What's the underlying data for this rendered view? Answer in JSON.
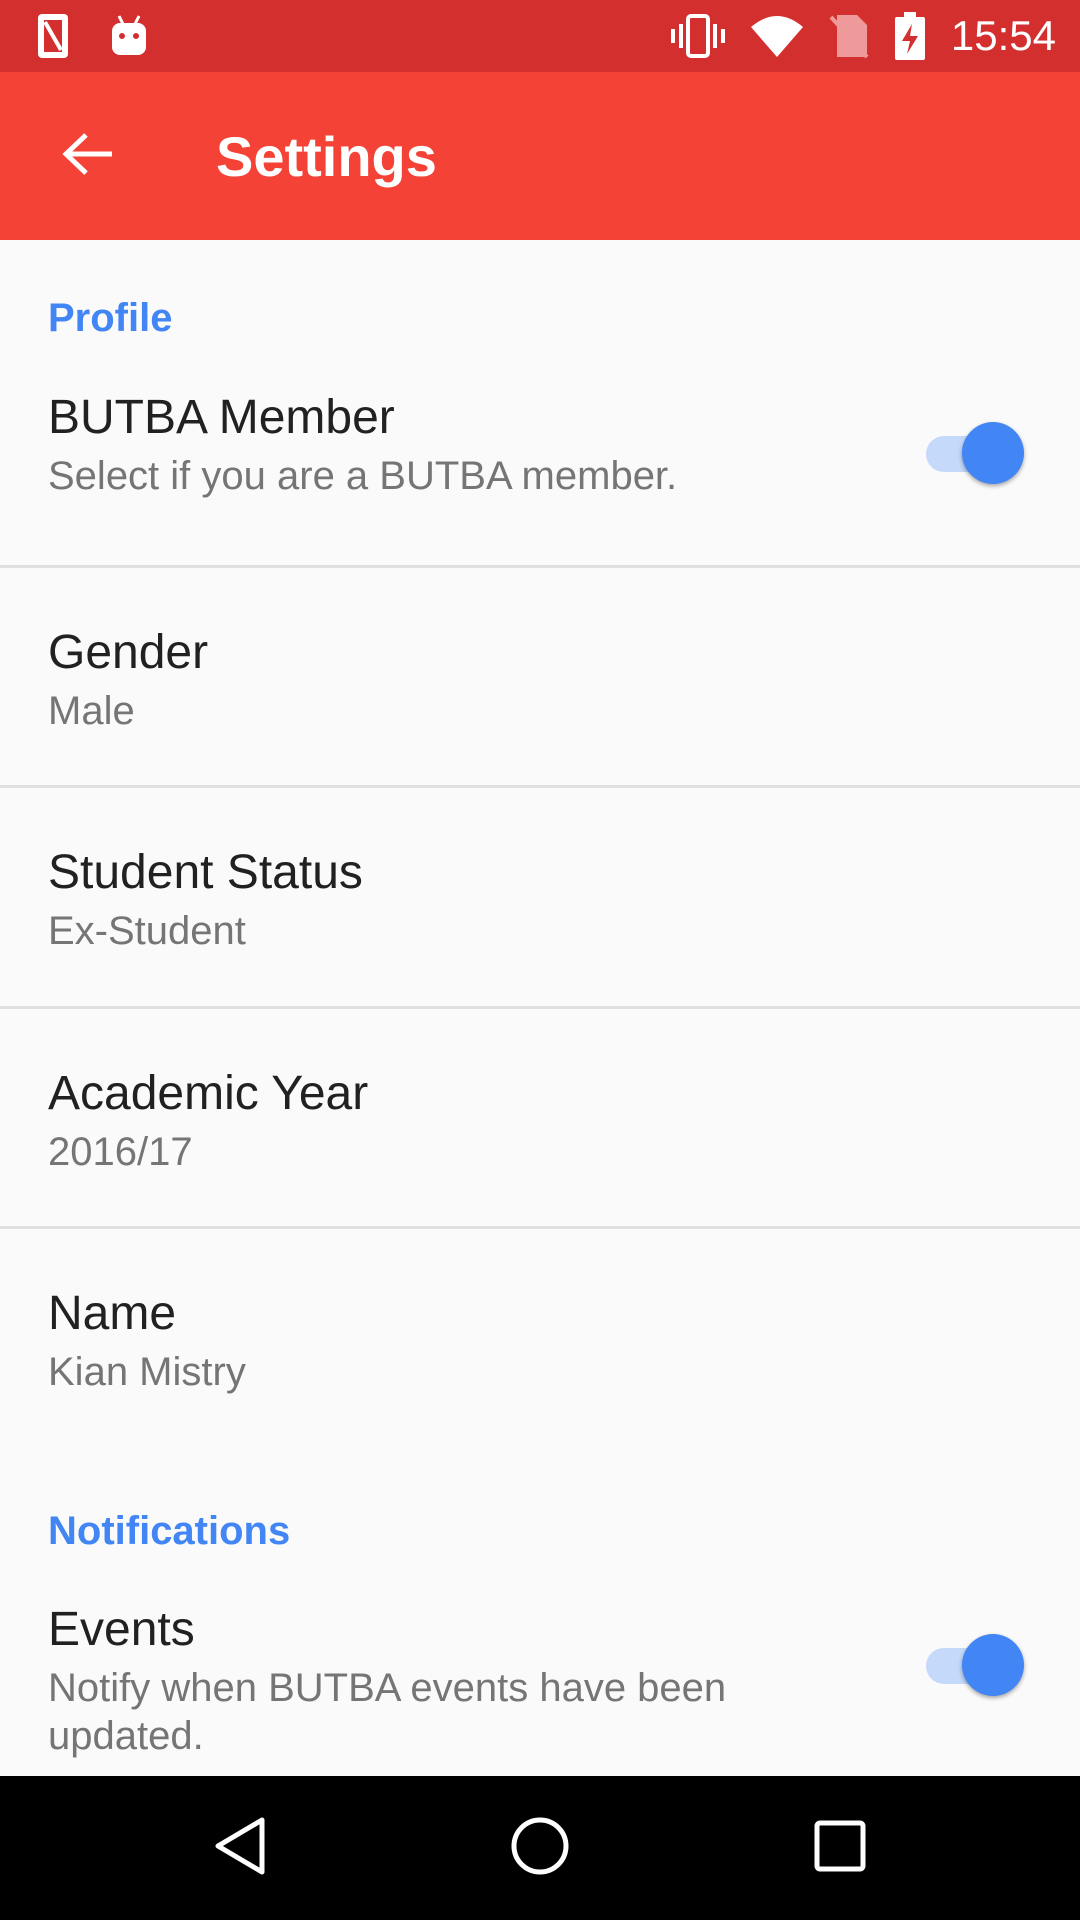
{
  "status_bar": {
    "time": "15:54",
    "background": "#d32f2f",
    "left_icons": [
      "sim-card-icon",
      "android-debug-icon"
    ],
    "right_icons": [
      "vibrate-icon",
      "wifi-icon",
      "no-sim-icon",
      "battery-charging-icon"
    ]
  },
  "app_bar": {
    "title": "Settings",
    "background": "#f44336",
    "back_icon": "arrow-back-icon"
  },
  "sections": {
    "profile": {
      "header": "Profile",
      "butba_member": {
        "title": "BUTBA Member",
        "summary": "Select if you are a BUTBA member.",
        "checked": true
      },
      "gender": {
        "title": "Gender",
        "summary": "Male"
      },
      "student_status": {
        "title": "Student Status",
        "summary": "Ex-Student"
      },
      "academic_year": {
        "title": "Academic Year",
        "summary": "2016/17"
      },
      "name": {
        "title": "Name",
        "summary": "Kian Mistry"
      }
    },
    "notifications": {
      "header": "Notifications",
      "events": {
        "title": "Events",
        "summary": "Notify when BUTBA events have been updated.",
        "checked": true
      }
    }
  },
  "colors": {
    "accent": "#4285f4",
    "switch_track": "#c5d9fb",
    "title_text": "#212121",
    "summary_text": "#757575"
  },
  "nav_bar": {
    "icons": [
      "back-triangle-icon",
      "home-circle-icon",
      "recents-square-icon"
    ]
  }
}
